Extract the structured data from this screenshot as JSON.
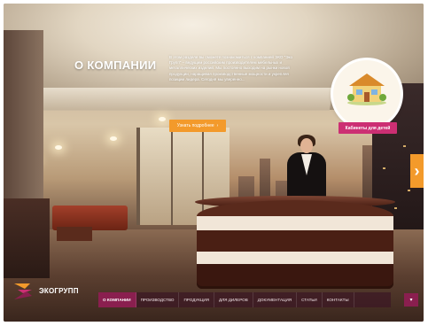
{
  "section": {
    "title": "О КОМПАНИИ",
    "intro": "В этом разделе вы сможете познакомиться с компанией ЭКО \"Эко Групп\" – ведущим российским производителем мебельных и металлических изделий. Мы постоянно выходим на рынки новой продукции, наращивая производственные мощности и укрепляя позиции лидера. Сегодня мы уверенно...",
    "more_label": "Узнать подробнее",
    "more_arrow": "›"
  },
  "promo": {
    "label": "Кабинеты для детей",
    "icon": "house-illustration"
  },
  "carousel": {
    "next_label": "›"
  },
  "brand": {
    "name": "ЭКОГРУПП",
    "colors": {
      "accent": "#f39a2b",
      "primary": "#8a1f4f",
      "pink": "#cc2f73"
    }
  },
  "nav": {
    "items": [
      {
        "label": "О КОМПАНИИ",
        "active": true
      },
      {
        "label": "ПРОИЗВОДСТВО",
        "active": false
      },
      {
        "label": "ПРОДУКЦИЯ",
        "active": false
      },
      {
        "label": "ДЛЯ ДИЛЕРОВ",
        "active": false
      },
      {
        "label": "ДОКУМЕНТАЦИЯ",
        "active": false
      },
      {
        "label": "СТАТЬИ",
        "active": false
      },
      {
        "label": "КОНТАКТЫ",
        "active": false
      }
    ],
    "end_label": "▾"
  }
}
